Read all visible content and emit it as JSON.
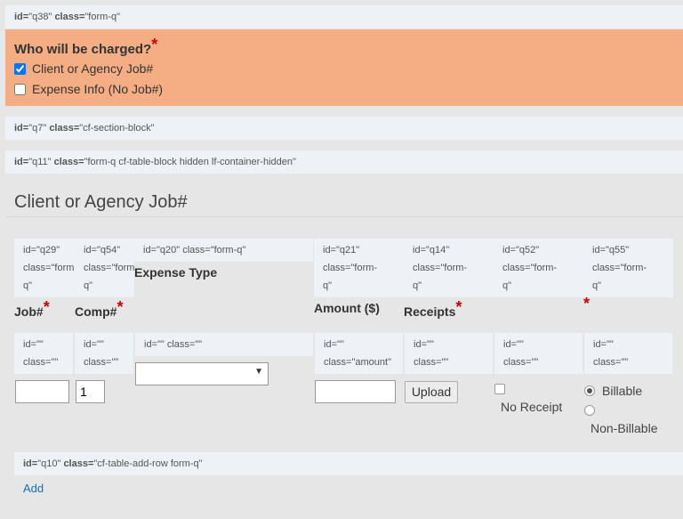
{
  "q38_bar": {
    "id_label": "id=",
    "id_val": "\"q38\"",
    "class_label": "class=",
    "class_val": "\"form-q\""
  },
  "q38": {
    "title": "Who will be charged?",
    "required_mark": "*",
    "options": [
      {
        "label": "Client or Agency Job#",
        "checked": true
      },
      {
        "label": "Expense Info (No Job#)",
        "checked": false
      }
    ]
  },
  "q7_bar": {
    "id_label": "id=",
    "id_val": "\"q7\"",
    "class_label": "class=",
    "class_val": "\"cf-section-block\""
  },
  "q11_bar": {
    "id_label": "id=",
    "id_val": "\"q11\"",
    "class_label": "class=",
    "class_val": "\"form-q cf-table-block hidden lf-container-hidden\""
  },
  "section_title": "Client or Agency Job#",
  "header_cells": [
    {
      "line1": "id=\"q29\"",
      "line2": "class=\"form-",
      "line3": "q\""
    },
    {
      "line1": "id=\"q54\"",
      "line2": "class=\"form-",
      "line3": "q\""
    },
    {
      "line1": "id=\"q20\" class=\"form-q\"",
      "line2": "",
      "line3": ""
    },
    {
      "line1": "id=\"q21\"",
      "line2": "class=\"form-",
      "line3": "q\""
    },
    {
      "line1": "id=\"q14\"",
      "line2": "class=\"form-",
      "line3": "q\""
    },
    {
      "line1": "id=\"q52\"",
      "line2": "class=\"form-",
      "line3": "q\""
    },
    {
      "line1": "id=\"q55\"",
      "line2": "class=\"form-",
      "line3": "q\""
    }
  ],
  "columns": {
    "job": "Job#",
    "comp": "Comp#",
    "expense_type": "Expense Type",
    "amount": "Amount ($)",
    "receipts": "Receipts",
    "req": "*"
  },
  "row_cells": [
    {
      "line1": "id=\"\"",
      "line2": "class=\"\""
    },
    {
      "line1": "id=\"\"",
      "line2": "class=\"\""
    },
    {
      "line1": "id=\"\" class=\"\"",
      "line2": ""
    },
    {
      "line1": "id=\"\"",
      "line2": "class=\"amount\""
    },
    {
      "line1": "id=\"\"",
      "line2": "class=\"\""
    },
    {
      "line1": "id=\"\"",
      "line2": "class=\"\""
    },
    {
      "line1": "id=\"\"",
      "line2": "class=\"\""
    }
  ],
  "row": {
    "job_value": "",
    "comp_value": "1",
    "expense_type_value": "",
    "amount_value": "",
    "upload_label": "Upload",
    "no_receipt_label": "No Receipt",
    "billable_label": "Billable",
    "non_billable_label": "Non-Billable",
    "billable_selected": true
  },
  "q10_bar": {
    "id_label": "id=",
    "id_val": "\"q10\"",
    "class_label": "class=",
    "class_val": "\"cf-table-add-row form-q\""
  },
  "add_link": "Add"
}
